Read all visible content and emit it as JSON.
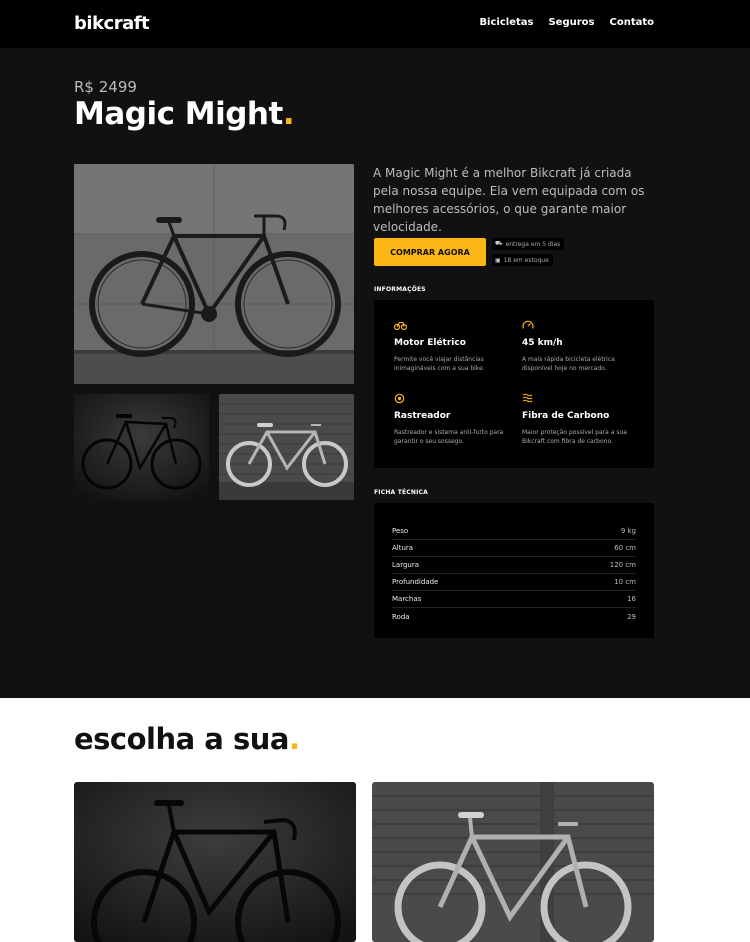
{
  "header": {
    "logo": "bikcraft",
    "nav": [
      "Bicicletas",
      "Seguros",
      "Contato"
    ]
  },
  "product": {
    "price": "R$ 2499",
    "name": "Magic Might",
    "name_dot": ".",
    "description": "A Magic Might é a melhor Bikcraft já criada pela nossa equipe. Ela vem equipada com os melhores acessórios, o que garante maior velocidade.",
    "buy_label": "COMPRAR AGORA",
    "delivery": "entrega em 5 dias",
    "stock": "18 em estoque"
  },
  "info": {
    "label": "INFORMAÇÕES",
    "features": [
      {
        "icon": "bike-icon",
        "title": "Motor Elétrico",
        "text": "Permite você viajar distâncias inimagináveis com a sua bike."
      },
      {
        "icon": "speedometer-icon",
        "title": "45 km/h",
        "text": "A mais rápida bicicleta elétrica disponível hoje no mercado."
      },
      {
        "icon": "location-icon",
        "title": "Rastreador",
        "text": "Rastreador e sistema anti-furto para garantir o seu sossego."
      },
      {
        "icon": "carbon-icon",
        "title": "Fibra de Carbono",
        "text": "Maior proteção possível para a sua Bikcraft com fibra de carbono."
      }
    ]
  },
  "specs": {
    "label": "FICHA TÉCNICA",
    "rows": [
      {
        "key": "Peso",
        "value": "9 kg"
      },
      {
        "key": "Altura",
        "value": "60 cm"
      },
      {
        "key": "Largura",
        "value": "120 cm"
      },
      {
        "key": "Profundidade",
        "value": "10 cm"
      },
      {
        "key": "Marchas",
        "value": "16"
      },
      {
        "key": "Roda",
        "value": "29"
      }
    ]
  },
  "choose": {
    "title": "escolha a sua",
    "dot": "."
  },
  "colors": {
    "accent": "#FBB615",
    "header_bg": "#000000",
    "section_bg": "#111111"
  }
}
